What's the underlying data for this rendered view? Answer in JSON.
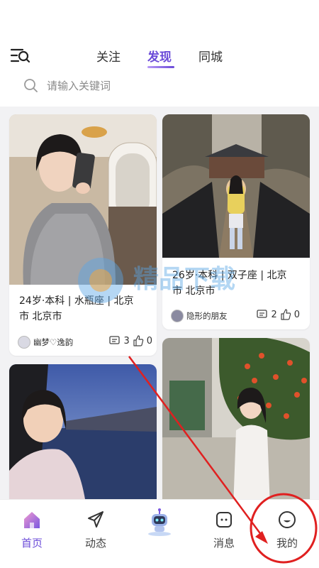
{
  "tabs": {
    "follow": "关注",
    "discover": "发现",
    "city": "同城"
  },
  "search": {
    "placeholder": "请输入关键词"
  },
  "cards": [
    {
      "info_line1": "24岁·本科 | 水瓶座 | 北京",
      "info_line2": "市 北京市",
      "user": "幽梦♡逸韵",
      "comments": "3",
      "likes": "0"
    },
    {
      "info_line1": "26岁·本科 | 双子座 | 北京",
      "info_line2": "市 北京市",
      "user": "隐形的朋友",
      "comments": "2",
      "likes": "0"
    }
  ],
  "bottom_nav": {
    "home": "首页",
    "moments": "动态",
    "messages": "消息",
    "mine": "我的"
  },
  "colors": {
    "accent": "#6b4bd8",
    "annotation": "#e02020"
  }
}
